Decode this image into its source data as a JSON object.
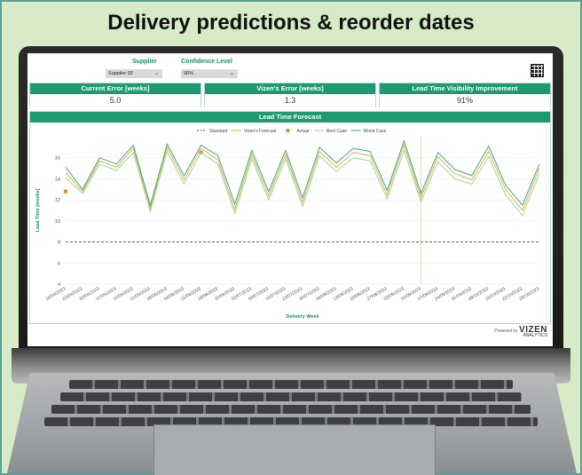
{
  "headline": "Delivery predictions & reorder dates",
  "filters": {
    "supplier_label": "Supplier",
    "supplier_value": "Supplier 02",
    "confidence_label": "Confidence Level",
    "confidence_value": "90%"
  },
  "kpis": [
    {
      "label": "Current Error [weeks]",
      "value": "5.0"
    },
    {
      "label": "Vizen's Error [weeks]",
      "value": "1.3"
    },
    {
      "label": "Lead Time Visibility Improvement",
      "value": "91%"
    }
  ],
  "chart_title": "Lead Time Forecast",
  "footer": {
    "powered": "Powered by",
    "brand": "VIZEN",
    "brand_sub": "ANALYTICS"
  },
  "colors": {
    "accent": "#1d9a72",
    "standard": "#555555",
    "forecast": "#e0b33a",
    "actual": "#e8852b",
    "best": "#9fd49a",
    "worst": "#3aa88f"
  },
  "chart_data": {
    "type": "line",
    "title": "Lead Time Forecast",
    "xlabel": "Delivery Week",
    "ylabel": "Lead Time [weeks]",
    "ylim": [
      4,
      18
    ],
    "yticks": [
      4,
      6,
      8,
      10,
      12,
      14,
      16
    ],
    "legend_position": "top",
    "categories": [
      "16/04/2023",
      "23/04/2023",
      "30/04/2023",
      "07/05/2023",
      "14/05/2023",
      "21/05/2023",
      "28/05/2023",
      "04/06/2023",
      "11/06/2023",
      "18/06/2023",
      "25/06/2023",
      "02/07/2023",
      "09/07/2023",
      "16/07/2023",
      "23/07/2023",
      "30/07/2023",
      "06/08/2023",
      "13/08/2023",
      "20/08/2023",
      "27/08/2023",
      "03/09/2023",
      "10/09/2023",
      "17/09/2023",
      "24/09/2023",
      "01/10/2023",
      "08/10/2023",
      "15/10/2023",
      "22/10/2023",
      "29/10/2023"
    ],
    "series": [
      {
        "name": "Standard",
        "values": [
          8,
          8,
          8,
          8,
          8,
          8,
          8,
          8,
          8,
          8,
          8,
          8,
          8,
          8,
          8,
          8,
          8,
          8,
          8,
          8,
          8,
          8,
          8,
          8,
          8,
          8,
          8,
          8,
          8
        ]
      },
      {
        "name": "Vizen's Forecast",
        "values": [
          14.6,
          12.8,
          15.7,
          15.1,
          16.9,
          11.2,
          17.0,
          13.9,
          16.9,
          15.8,
          11.1,
          16.3,
          12.4,
          16.3,
          11.8,
          16.6,
          15.1,
          16.5,
          16.2,
          12.5,
          17.2,
          12.2,
          16.1,
          14.5,
          13.9,
          16.6,
          13.0,
          11.0,
          15.0
        ]
      },
      {
        "name": "Actual",
        "values": [
          12.8,
          null,
          null,
          null,
          null,
          null,
          null,
          null,
          16.5,
          null,
          null,
          null,
          null,
          null,
          null,
          null,
          null,
          null,
          null,
          null,
          null,
          null,
          null,
          null,
          null,
          null,
          null,
          null,
          null
        ]
      },
      {
        "name": "Best Case",
        "values": [
          14.1,
          12.6,
          15.4,
          14.8,
          16.5,
          10.9,
          16.6,
          13.5,
          16.5,
          15.4,
          10.7,
          15.9,
          12.0,
          15.9,
          11.4,
          16.2,
          14.7,
          16.0,
          15.7,
          12.1,
          16.7,
          11.8,
          15.6,
          14.0,
          13.5,
          16.1,
          12.5,
          10.5,
          14.5
        ]
      },
      {
        "name": "Worst Case",
        "values": [
          15.1,
          13.0,
          16.0,
          15.4,
          17.2,
          11.5,
          17.3,
          14.3,
          17.2,
          16.2,
          11.6,
          16.7,
          12.8,
          16.7,
          12.2,
          17.0,
          15.5,
          16.9,
          16.6,
          12.9,
          17.6,
          12.6,
          16.5,
          14.9,
          14.3,
          17.1,
          13.4,
          11.5,
          15.4
        ]
      }
    ]
  }
}
